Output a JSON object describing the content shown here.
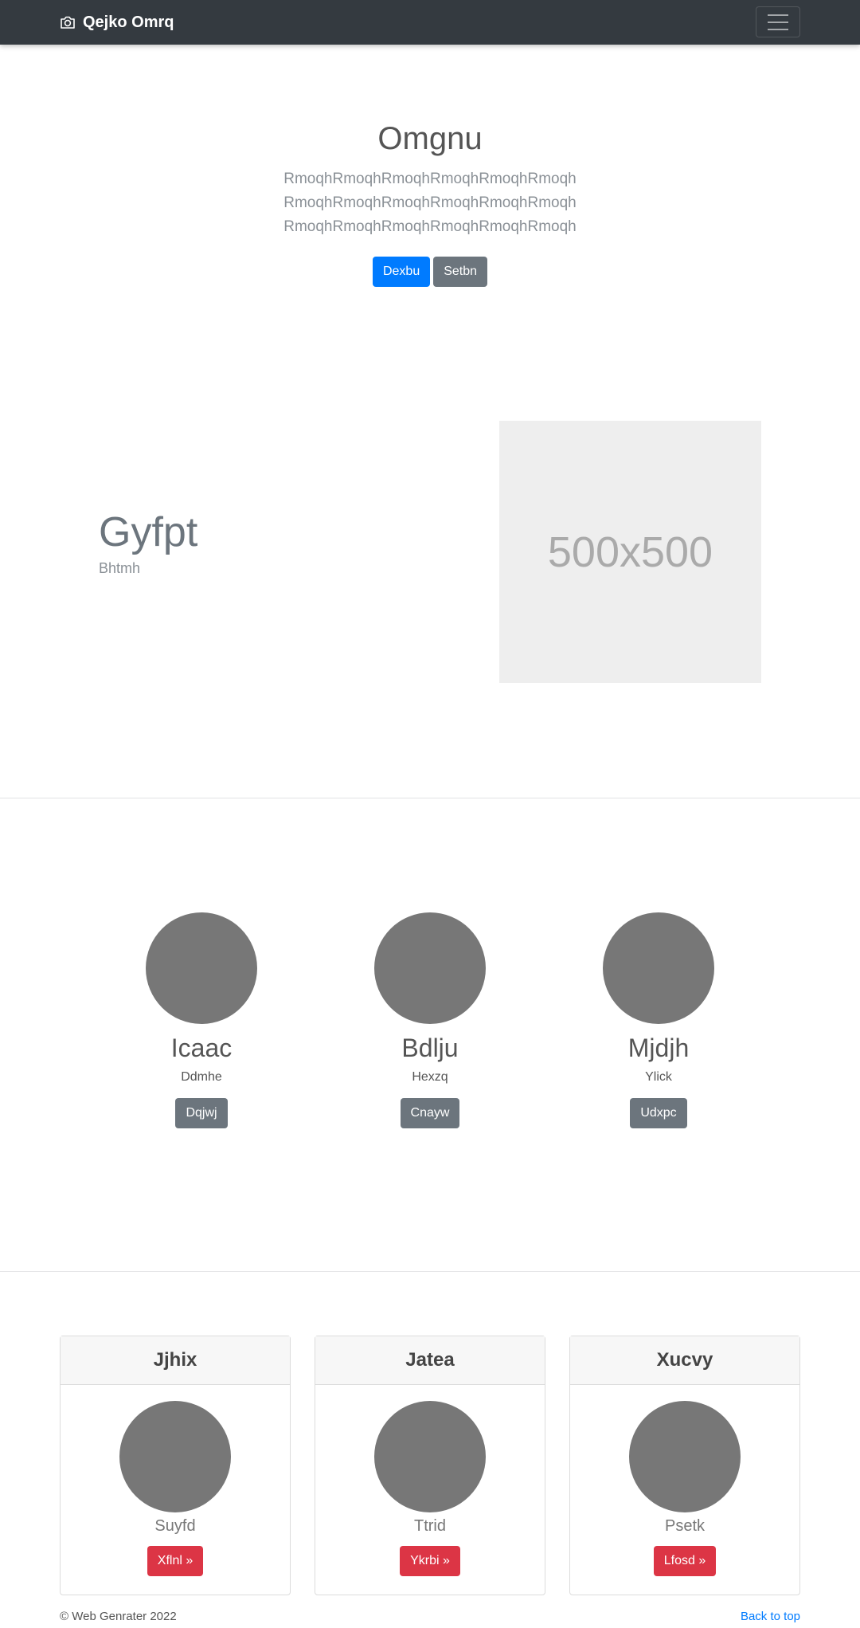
{
  "navbar": {
    "brand": "Qejko Omrq",
    "brand_icon": "camera-icon",
    "toggler_icon": "hamburger-icon"
  },
  "hero": {
    "title": "Omgnu",
    "lead_lines": [
      "RmoqhRmoqhRmoqhRmoqhRmoqhRmoqh",
      "RmoqhRmoqhRmoqhRmoqhRmoqhRmoqh",
      "RmoqhRmoqhRmoqhRmoqhRmoqhRmoqh"
    ],
    "primary_button": "Dexbu",
    "secondary_button": "Setbn"
  },
  "feature": {
    "heading": "Gyfpt",
    "subheading": "Bhtmh",
    "placeholder": "500x500"
  },
  "columns": [
    {
      "name": "Icaac",
      "desc": "Ddmhe",
      "button": "Dqjwj"
    },
    {
      "name": "Bdlju",
      "desc": "Hexzq",
      "button": "Cnayw"
    },
    {
      "name": "Mjdjh",
      "desc": "Ylick",
      "button": "Udxpc"
    }
  ],
  "cards": [
    {
      "header": "Jjhix",
      "sub": "Suyfd",
      "button": "Xflnl »"
    },
    {
      "header": "Jatea",
      "sub": "Ttrid",
      "button": "Ykrbi »"
    },
    {
      "header": "Xucvy",
      "sub": "Psetk",
      "button": "Lfosd »"
    }
  ],
  "footer": {
    "copyright": "© Web Genrater 2022",
    "back_to_top": "Back to top"
  },
  "colors": {
    "navbar": "#343a40",
    "primary": "#007bff",
    "secondary": "#6c757d",
    "danger": "#dc3545",
    "circle": "#777777"
  }
}
